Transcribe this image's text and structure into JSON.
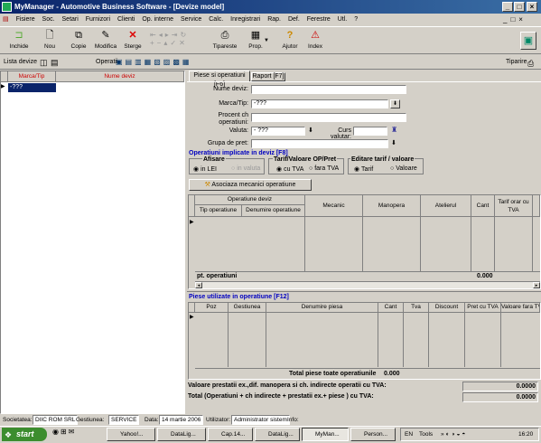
{
  "title": "MyManager - Automotive Business Software - [Devize model]",
  "menu": [
    "Fisiere",
    "Soc.",
    "Setari",
    "Furnizori",
    "Clienti",
    "Op. interne",
    "Service",
    "Calc.",
    "Inregistrari",
    "Rap.",
    "Def.",
    "Ferestre",
    "Utl.",
    "?"
  ],
  "toolbar": {
    "inchide": "Inchide",
    "nou": "Nou",
    "copie": "Copie",
    "modifica": "Modifica",
    "sterge": "Sterge",
    "tipareste": "Tipareste",
    "prop": "Prop.",
    "ajutor": "Ajutor",
    "index": "Index"
  },
  "tb2": {
    "lista": "Lista devize",
    "operatii": "Operatii",
    "tiparire": "Tiparire"
  },
  "left": {
    "col1": "Marca/Tip",
    "col2": "Nume deviz",
    "row1": "-???"
  },
  "tabs": {
    "tab1": "Piese si operatiuni [F6]",
    "tab2": "Raport [F7]"
  },
  "form": {
    "nume_deviz_lbl": "Nume deviz:",
    "nume_deviz": "",
    "marca_lbl": "Marca/Tip:",
    "marca": "-???",
    "procent_lbl": "Procent ch operatiuni:",
    "procent": "",
    "valuta_lbl": "Valuta:",
    "valuta": "- ???",
    "curs_lbl": "Curs valutar:",
    "curs": "",
    "grupa_lbl": "Grupa de pret:",
    "grupa": ""
  },
  "ops": {
    "title": "Operatiuni implicate in deviz [F8]",
    "afisare": "Afisare",
    "in_lei": "in LEI",
    "in_valuta": "in valuta",
    "tarif_op": "Tarif/Valoare OP/Pret",
    "cu_tva": "cu TVA",
    "fara_tva": "fara TVA",
    "editare": "Editare tarif / valoare",
    "tarif": "Tarif",
    "valoare": "Valoare",
    "asociaza": "Asociaza mecanici operatiune"
  },
  "opgrid": {
    "h_op": "Operatiune deviz",
    "h_tip": "Tip operatiune",
    "h_den": "Denumire operatiune",
    "h_mec": "Mecanic",
    "h_man": "Manopera",
    "h_at": "Atelierul",
    "h_cant": "Cant",
    "h_tarif": "Tarif orar cu TVA",
    "tot_lbl": "pt. operatiuni",
    "tot_val": "0.000"
  },
  "piese": {
    "title": "Piese utilizate in operatiune [F12]",
    "h_poz": "Poz",
    "h_gest": "Gestiunea",
    "h_den": "Denumire piesa",
    "h_cant": "Cant",
    "h_tva": "Tva",
    "h_disc": "Discount",
    "h_pret": "Pret cu TVA",
    "h_val": "Valoare fara TVA",
    "tot_lbl": "Total piese toate operatiunile",
    "tot_val": "0.000"
  },
  "totals": {
    "l1": "Valoare prestatii ex.,dif. manopera si ch. indirecte operatii cu TVA:",
    "v1": "0.0000",
    "l2": "Total (Operatiuni + ch indirecte + prestatii ex.+ piese ) cu TVA:",
    "v2": "0.0000"
  },
  "status": {
    "soc_lbl": "Societatea:",
    "soc": "DIIC ROM SRL",
    "gest_lbl": "Gestiunea:",
    "gest": "SERVICE",
    "data_lbl": "Data:",
    "data": "14 martie 2006",
    "util_lbl": "Utilizator:",
    "util": "Administrator sistem",
    "info": "Info:"
  },
  "taskbar": {
    "start": "start",
    "tasks": [
      "Yahoo!...",
      "DataLig...",
      "Cap.14...",
      "DataLig...",
      "MyMan...",
      "Person..."
    ],
    "lang": "EN",
    "tools": "Tools",
    "clock": "16:20"
  },
  "colors": {
    "title_blue": "#0a246a",
    "section_blue": "#0000c0",
    "start_green": "#3c8d2e"
  }
}
